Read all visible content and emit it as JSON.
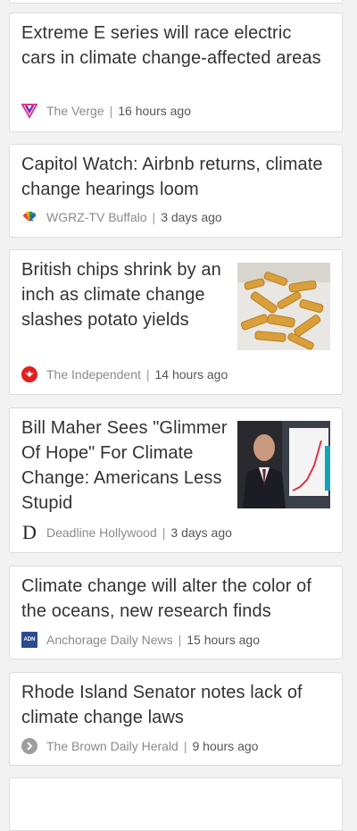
{
  "articles": [
    {
      "headline": "Extreme E series will race electric cars in climate change-affected areas",
      "source": "The Verge",
      "time": "16 hours ago",
      "logo": "verge-logo-icon"
    },
    {
      "headline": "Capitol Watch: Airbnb returns, climate change hearings loom",
      "source": "WGRZ-TV Buffalo",
      "time": "3 days ago",
      "logo": "nbc-peacock-icon"
    },
    {
      "headline": "British chips shrink by an inch as climate change slashes potato yields",
      "source": "The Independent",
      "time": "14 hours ago",
      "logo": "independent-eagle-icon",
      "thumb": "potato-chips-photo"
    },
    {
      "headline": "Bill Maher Sees \"Glimmer Of Hope\" For Climate Change: Americans Less Stupid",
      "source": "Deadline Hollywood",
      "time": "3 days ago",
      "logo": "deadline-d-icon",
      "thumb": "bill-maher-photo"
    },
    {
      "headline": "Climate change will alter the color of the oceans, new research finds",
      "source": "Anchorage Daily News",
      "time": "15 hours ago",
      "logo": "adn-logo-icon"
    },
    {
      "headline": "Rhode Island Senator notes lack of climate change laws",
      "source": "The Brown Daily Herald",
      "time": "9 hours ago",
      "logo": "chevron-circle-icon"
    }
  ],
  "logo_texts": {
    "deadline": "D",
    "adn": "ADN"
  },
  "colors": {
    "verge": "#9b2dbc",
    "independent": "#e02020",
    "adn": "#2b4b8c",
    "chevron": "#999999"
  }
}
